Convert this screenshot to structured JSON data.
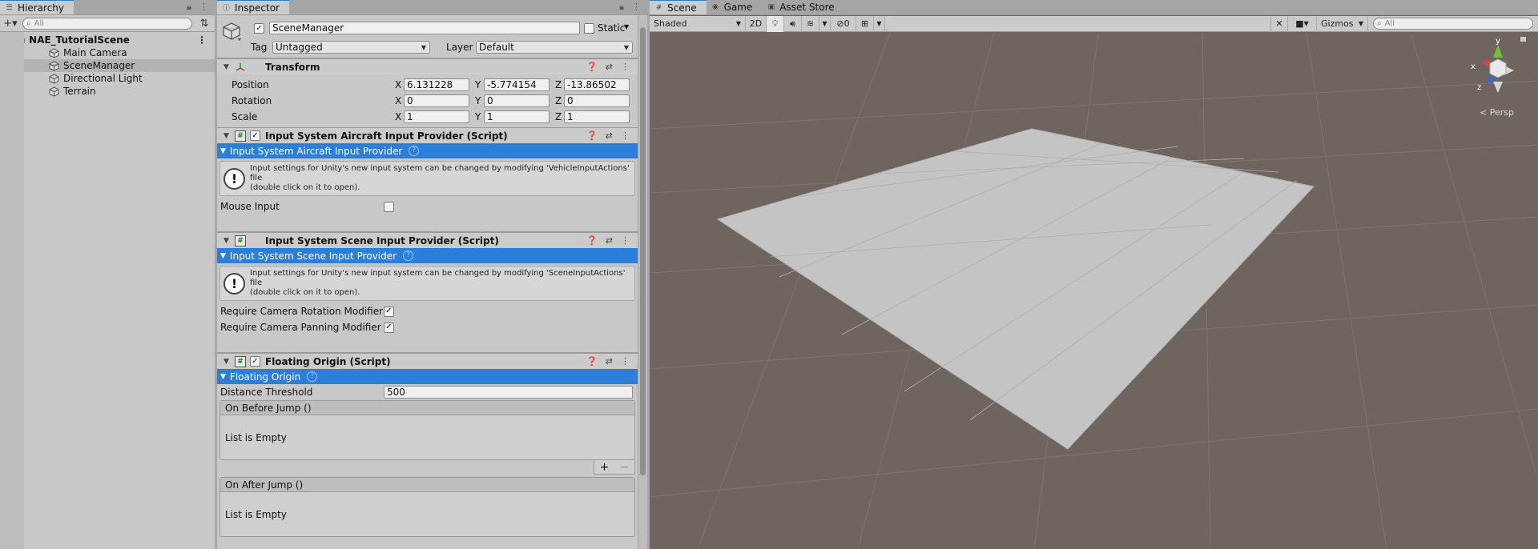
{
  "hierarchy": {
    "tab_label": "Hierarchy",
    "search_placeholder": "All",
    "scene_name": "NAE_TutorialScene",
    "items": [
      {
        "label": "Main Camera"
      },
      {
        "label": "SceneManager",
        "selected": true
      },
      {
        "label": "Directional Light"
      },
      {
        "label": "Terrain"
      }
    ]
  },
  "inspector": {
    "tab_label": "Inspector",
    "object_name": "SceneManager",
    "static_label": "Static",
    "tag_label": "Tag",
    "tag_value": "Untagged",
    "layer_label": "Layer",
    "layer_value": "Default",
    "transform": {
      "title": "Transform",
      "position_label": "Position",
      "rotation_label": "Rotation",
      "scale_label": "Scale",
      "axis_x": "X",
      "axis_y": "Y",
      "axis_z": "Z",
      "position": {
        "x": "6.131228",
        "y": "-5.774154",
        "z": "-13.86502"
      },
      "rotation": {
        "x": "0",
        "y": "0",
        "z": "0"
      },
      "scale": {
        "x": "1",
        "y": "1",
        "z": "1"
      }
    },
    "aircraft": {
      "title": "Input System Aircraft Input Provider (Script)",
      "section": "Input System Aircraft Input Provider",
      "help_line1": "Input settings for Unity's new input system can be changed by modifying 'VehicleInputActions' file",
      "help_line2": "(double click on it to open).",
      "mouse_input_label": "Mouse Input"
    },
    "scene_input": {
      "title": "Input System Scene Input Provider (Script)",
      "section": "Input System Scene Input Provider",
      "help_line1": "Input settings for Unity's new input system can be changed by modifying 'SceneInputActions' file",
      "help_line2": "(double click on it to open).",
      "rotation_modifier_label": "Require Camera Rotation Modifier",
      "panning_modifier_label": "Require Camera Panning Modifier"
    },
    "floating_origin": {
      "title": "Floating Origin (Script)",
      "section": "Floating Origin",
      "distance_label": "Distance Threshold",
      "distance_value": "500",
      "before_jump_label": "On Before Jump ()",
      "after_jump_label": "On After Jump ()",
      "empty_label": "List is Empty",
      "plus": "+",
      "minus": "−"
    }
  },
  "scene_view": {
    "tabs": [
      {
        "label": "Scene"
      },
      {
        "label": "Game"
      },
      {
        "label": "Asset Store"
      }
    ],
    "shading_mode": "Shaded",
    "btn_2d": "2D",
    "hidden_count": "0",
    "gizmos_label": "Gizmos",
    "search_placeholder": "All",
    "persp_label": "< Persp",
    "gizmo_axis_x": "x",
    "gizmo_axis_y": "y",
    "gizmo_axis_z": "z"
  },
  "colors": {
    "accent": "#2c7fd8",
    "scene_bg": "#6e655e",
    "plane": "#c4c4c4"
  }
}
